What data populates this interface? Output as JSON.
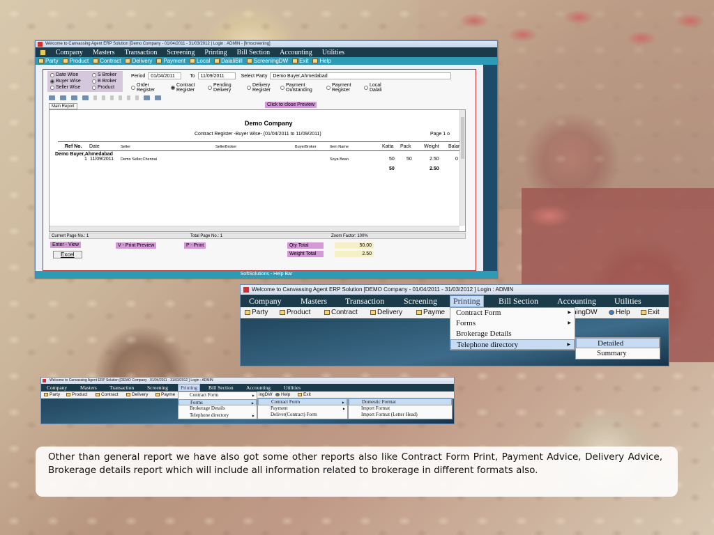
{
  "window1": {
    "title": "Welcome to Canvassing Agent ERP Solution [Demo Company - 01/04/2011 - 31/03/2012 | Login : ADMIN - [frmscreening]",
    "menu": [
      "Company",
      "Masters",
      "Transaction",
      "Screening",
      "Printing",
      "Bill Section",
      "Accounting",
      "Utilities"
    ],
    "toolbar": [
      "Party",
      "Product",
      "Contract",
      "Delivery",
      "Payment",
      "Local",
      "DalaliBill",
      "ScreeningDW",
      "Exit",
      "Help"
    ],
    "filters": {
      "group1": [
        "Date Wise",
        "Buyer Wise",
        "Seller Wise"
      ],
      "group2": [
        "S Broker",
        "B Broker",
        "Product"
      ],
      "selected": "Buyer Wise"
    },
    "period_label": "Period",
    "period_from": "01/04/2011",
    "to_label": "To",
    "period_to": "11/09/2011",
    "select_party_label": "Select Party",
    "select_party_value": "Demo Buyer,Ahmedabad",
    "registers": [
      {
        "line1": "Order",
        "line2": "Register",
        "on": false
      },
      {
        "line1": "Contract",
        "line2": "Register",
        "on": true
      },
      {
        "line1": "Pending",
        "line2": "Delivery",
        "on": false
      },
      {
        "line1": "Delivery",
        "line2": "Register",
        "on": false
      },
      {
        "line1": "Payment",
        "line2": "Outstanding",
        "on": false
      },
      {
        "line1": "Payment",
        "line2": "Register",
        "on": false
      },
      {
        "line1": "Local",
        "line2": "Dalali",
        "on": false
      }
    ],
    "tab_main": "Main Report",
    "close_preview": "Click to close Preview",
    "report": {
      "company": "Demo Company",
      "subtitle": "Contract Register -Buyer Wise-  (01/04/2011 to 11/09/2011)",
      "page": "Page 1 o",
      "headers": [
        "Ref No.",
        "Date",
        "Seller",
        "SellerBroker",
        "BuyerBroker",
        "Item Name",
        "Katta",
        "Pack",
        "Weight",
        "Balar"
      ],
      "group": "Demo Buyer,Ahmedabad",
      "row": {
        "ref": "1",
        "date": "11/09/2011",
        "seller": "Demo Seller,Chennai",
        "item": "Soya Bean",
        "katta": "50",
        "pack": "50",
        "weight": "2.50",
        "bal": "0"
      },
      "total": {
        "katta": "50",
        "weight": "2.50"
      }
    },
    "status": {
      "current_page": "Current Page No.: 1",
      "total_page": "Total Page No.: 1",
      "zoom": "Zoom Factor: 100%"
    },
    "buttons": {
      "view": "Enter - View",
      "print_preview": "V - Print Preview",
      "print": "P - Print",
      "excel": "Excel"
    },
    "summary": {
      "qty_label": "Qty Total",
      "qty_value": "50.00",
      "weight_label": "Weight Total",
      "weight_value": "2.50"
    },
    "help_bar": "SoftSolutions - Help Bar"
  },
  "window2": {
    "title": "Welcome to Canvassing Agent ERP Solution [DEMO Company - 01/04/2011 - 31/03/2012 ] Login : ADMIN",
    "menu": [
      "Company",
      "Masters",
      "Transaction",
      "Screening",
      "Printing",
      "Bill Section",
      "Accounting",
      "Utilities"
    ],
    "toolbar": [
      "Party",
      "Product",
      "Contract",
      "Delivery",
      "Payme",
      "hingDW",
      "Help",
      "Exit"
    ],
    "printing_menu": [
      "Contract Form",
      "Forms",
      "Brokerage Details",
      "Telephone directory"
    ],
    "submenu": [
      "Detailed",
      "Summary"
    ]
  },
  "window3": {
    "title": "Welcome to Canvassing Agent ERP Solution [DEMO Company - 01/04/2011 - 31/03/2012 ] Login : ADMIN",
    "menu": [
      "Company",
      "Masters",
      "Transaction",
      "Screening",
      "Printing",
      "Bill Section",
      "Accounting",
      "Utilities"
    ],
    "toolbar": [
      "Party",
      "Product",
      "Contract",
      "Delivery",
      "Payme",
      "ingDW",
      "Help",
      "Exit"
    ],
    "printing_menu": [
      "Contract Form",
      "Forms",
      "Brokerage Details",
      "Telephone directory"
    ],
    "forms_menu": [
      "Contract Form",
      "Payment",
      "Deliver(Contract) Form"
    ],
    "contract_menu": [
      "Domestic Format",
      "Import Format",
      "Import Format (Letter Head)"
    ]
  },
  "caption": "Other than general report we have also got some other reports also like Contract Form Print, Payment Advice, Delivery Advice, Brokerage details report which will include all information related to brokerage in different formats also."
}
